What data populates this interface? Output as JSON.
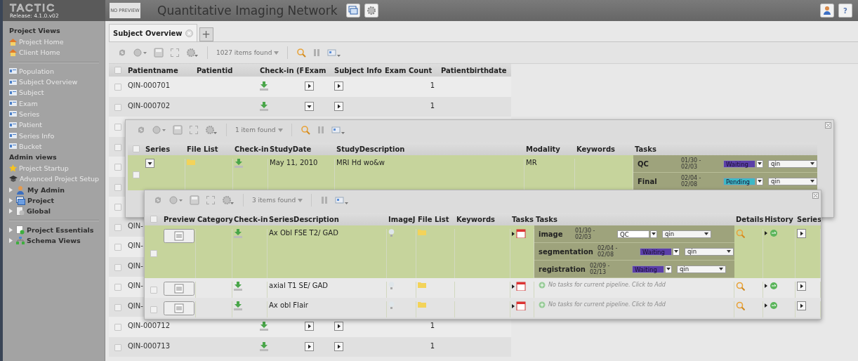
{
  "header": {
    "logo": "TACTIC",
    "release": "Release: 4.1.0.v02",
    "preview": "NO PREVIEW",
    "title": "Quantitative Imaging Network",
    "help": "?"
  },
  "sidebar": [
    {
      "kind": "heading",
      "label": "Project Views"
    },
    {
      "kind": "link",
      "label": "Project Home"
    },
    {
      "kind": "link",
      "label": "Client Home"
    },
    {
      "kind": "divider"
    },
    {
      "kind": "link",
      "label": "Population"
    },
    {
      "kind": "link",
      "label": "Subject Overview"
    },
    {
      "kind": "link",
      "label": "Subject"
    },
    {
      "kind": "link",
      "label": "Exam"
    },
    {
      "kind": "link",
      "label": "Series"
    },
    {
      "kind": "link",
      "label": "Patient"
    },
    {
      "kind": "link",
      "label": "Series Info"
    },
    {
      "kind": "link",
      "label": "Bucket"
    },
    {
      "kind": "heading",
      "label": "Admin views"
    },
    {
      "kind": "link",
      "label": "Project Startup"
    },
    {
      "kind": "link",
      "label": "Advanced Project Setup"
    },
    {
      "kind": "folder",
      "label": "My Admin",
      "expanded": false
    },
    {
      "kind": "folder",
      "label": "Project",
      "expanded": false
    },
    {
      "kind": "folder",
      "label": "Global",
      "expanded": false
    },
    {
      "kind": "divider"
    },
    {
      "kind": "folder",
      "label": "Project Essentials",
      "expanded": false
    },
    {
      "kind": "folder",
      "label": "Schema Views",
      "expanded": false
    }
  ],
  "tabs": [
    {
      "label": "Subject Overview",
      "selected": true
    }
  ],
  "new_tab": "+",
  "main": {
    "found": "1027 items found",
    "search": true,
    "all_checked": false,
    "columns": [
      "Patientname",
      "Patientid",
      "Check-in (F",
      "Exam",
      "Subject Info",
      "Exam Count",
      "Patientbirthdate"
    ],
    "rows": [
      {
        "kind": "full",
        "checked": false,
        "name": "QIN-000701",
        "exam_expanded": false,
        "count": "1"
      },
      {
        "kind": "full",
        "checked": false,
        "name": "QIN-000702",
        "exam_expanded": true,
        "count": "1"
      },
      {
        "kind": "covered",
        "checked": false
      },
      {
        "kind": "covered",
        "checked": false
      },
      {
        "kind": "covered",
        "checked": false
      },
      {
        "kind": "covered",
        "checked": false
      },
      {
        "kind": "covered",
        "checked": false
      },
      {
        "kind": "partial",
        "checked": false,
        "name": "QIN-"
      },
      {
        "kind": "partial",
        "checked": false,
        "name": "QIN-"
      },
      {
        "kind": "partial",
        "checked": false,
        "name": "QIN-"
      },
      {
        "kind": "partial",
        "checked": false,
        "name": "QIN-"
      },
      {
        "kind": "partial",
        "checked": false,
        "name": "QIN-"
      },
      {
        "kind": "full",
        "checked": false,
        "name": "QIN-000712",
        "exam_expanded": false,
        "count": "1"
      },
      {
        "kind": "full",
        "checked": false,
        "name": "QIN-000713",
        "exam_expanded": false,
        "count": "1"
      }
    ]
  },
  "studies": {
    "found": "1 item found",
    "search": true,
    "all_checked": false,
    "columns": [
      "Series",
      "File List",
      "Check-in",
      "StudyDate",
      "StudyDescription",
      "Modality",
      "Keywords",
      "Tasks"
    ],
    "rows": [
      {
        "selected": true,
        "checked": false,
        "series_expanded": true,
        "date": "May 11, 2010",
        "description": "MRI Hd wo&w",
        "modality": "MR",
        "tasks": [
          {
            "process": "QC",
            "dates": "01/30 - 02/03",
            "status": "Waiting",
            "color": "#5b3fa8",
            "assigned": "qin"
          },
          {
            "process": "Final",
            "dates": "02/04 - 02/08",
            "status": "Pending",
            "color": "#3cb8c6",
            "assigned": "qin"
          }
        ]
      }
    ]
  },
  "series": {
    "found": "3 items found",
    "search": false,
    "all_checked": false,
    "columns": [
      "Preview",
      "Category",
      "Check-in",
      "SeriesDescription",
      "ImageJ",
      "File List",
      "Keywords",
      "Tasks",
      "Tasks",
      "Details",
      "History",
      "Series"
    ],
    "rows": [
      {
        "selected": true,
        "checked": false,
        "description": "Ax Obl FSE T2/ GAD",
        "tasks": [
          {
            "process": "image",
            "dates": "01/30 - 02/03",
            "status": "QC",
            "color": "#ffffff",
            "assigned": "qin"
          },
          {
            "process": "segmentation",
            "dates": "02/04 - 02/08",
            "status": "Waiting",
            "color": "#5b3fa8",
            "assigned": "qin"
          },
          {
            "process": "registration",
            "dates": "02/09 - 02/13",
            "status": "Waiting",
            "color": "#5b3fa8",
            "assigned": "qin"
          }
        ]
      },
      {
        "selected": false,
        "checked": false,
        "description": "axial T1 SE/ GAD",
        "no_tasks": "No tasks for current pipeline. Click to Add"
      },
      {
        "selected": false,
        "checked": false,
        "description": "Ax obl Flair",
        "no_tasks": "No tasks for current pipeline. Click to Add"
      }
    ]
  }
}
